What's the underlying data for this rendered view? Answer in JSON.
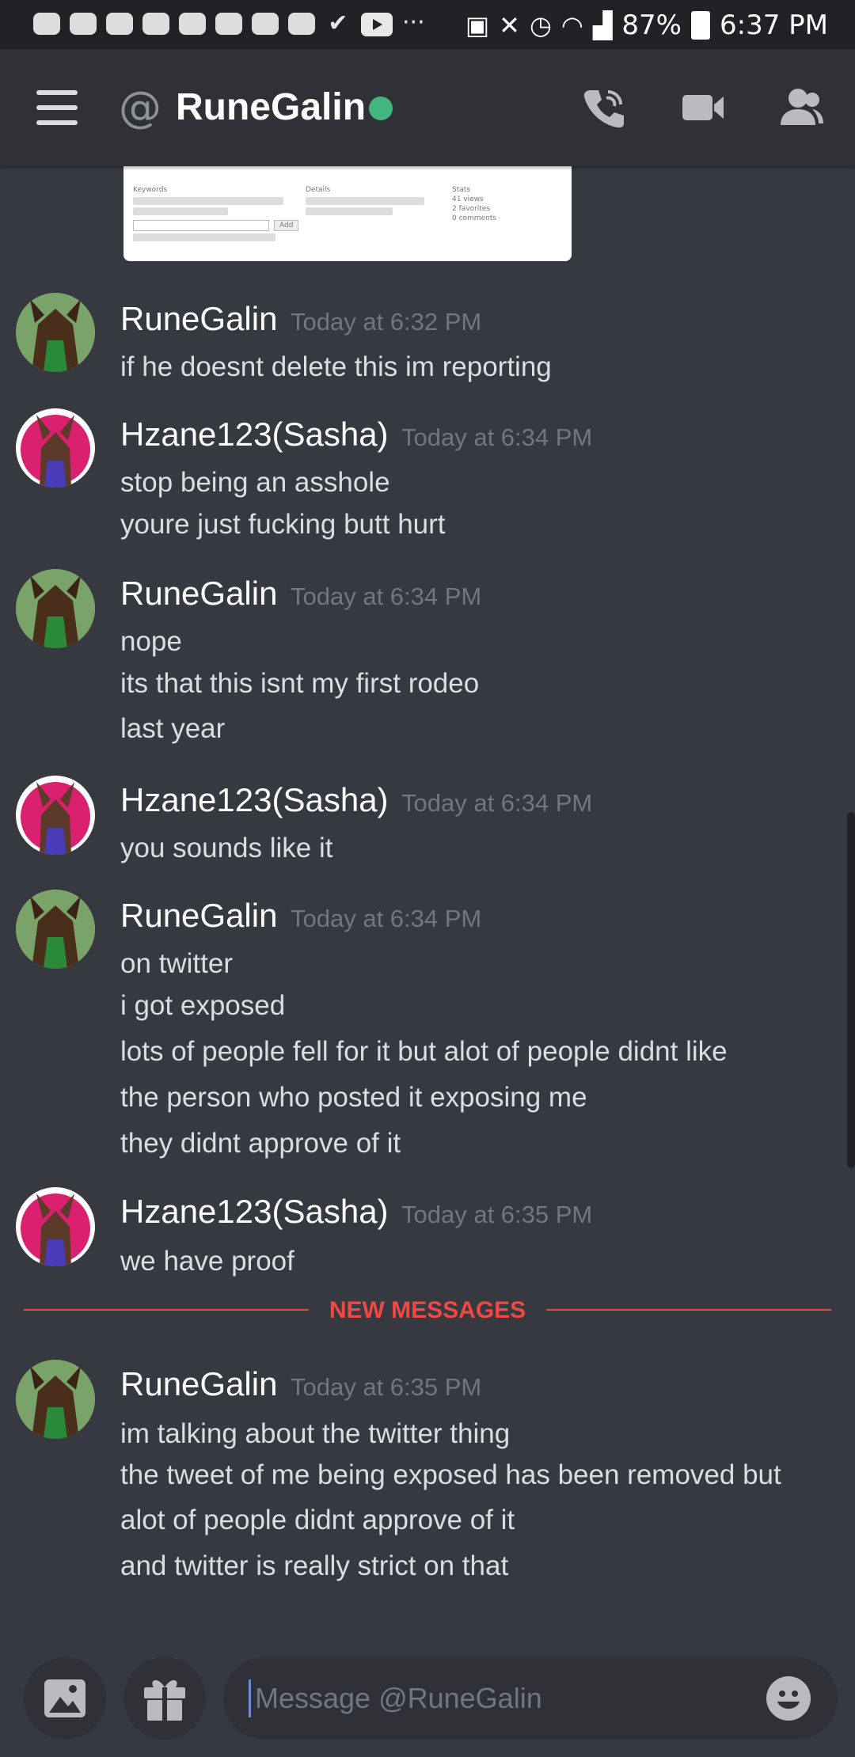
{
  "status_bar": {
    "battery": "87%",
    "time": "6:37 PM",
    "overflow": "···"
  },
  "header": {
    "at_symbol": "@",
    "title": "RuneGalin",
    "presence": "online"
  },
  "messages": [
    {
      "author": "RuneGalin",
      "timestamp": "Today at 6:32 PM",
      "lines": [
        "if he doesnt delete this im reporting"
      ]
    },
    {
      "author": "Hzane123(Sasha)",
      "timestamp": "Today at 6:34 PM",
      "lines": [
        "stop being an asshole",
        "youre just fucking butt hurt"
      ]
    },
    {
      "author": "RuneGalin",
      "timestamp": "Today at 6:34 PM",
      "lines": [
        "nope",
        "its that this isnt my first rodeo",
        "last year"
      ]
    },
    {
      "author": "Hzane123(Sasha)",
      "timestamp": "Today at 6:34 PM",
      "lines": [
        "you sounds like it"
      ]
    },
    {
      "author": "RuneGalin",
      "timestamp": "Today at 6:34 PM",
      "lines": [
        "on twitter",
        "i got exposed",
        "lots of people fell for it but alot of people didnt like",
        "the person who posted it exposing me",
        "they didnt approve of it"
      ]
    },
    {
      "author": "Hzane123(Sasha)",
      "timestamp": "Today at 6:35 PM",
      "lines": [
        "we have proof"
      ]
    },
    {
      "author": "RuneGalin",
      "timestamp": "Today at 6:35 PM",
      "lines": [
        "im talking about the twitter thing",
        "the tweet of me being exposed has been removed but",
        "alot of people didnt approve of it",
        "and twitter is really strict on that"
      ]
    }
  ],
  "new_messages_label": "NEW MESSAGES",
  "embed": {
    "col1_title": "Keywords",
    "col2_title": "Details",
    "col3_title": "Stats",
    "col3_lines": [
      "41 views",
      "2 favorites",
      "0 comments"
    ],
    "add_button": "Add"
  },
  "composer": {
    "placeholder": "Message @RuneGalin"
  },
  "colors": {
    "online": "#43b581",
    "new_messages": "#f04747",
    "background": "#36393f"
  }
}
